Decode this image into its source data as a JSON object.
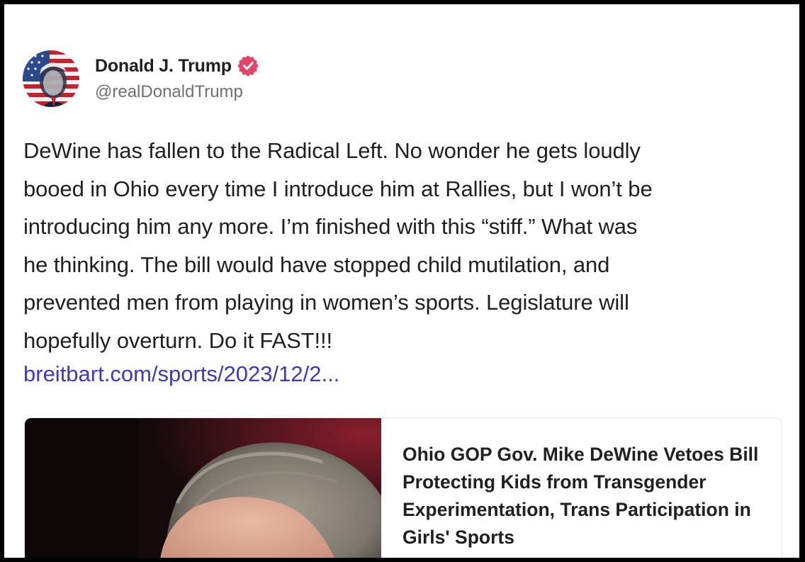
{
  "author": {
    "display_name": "Donald J. Trump",
    "handle": "@realDonaldTrump",
    "avatar_icon": "avatar-flag-portrait",
    "verified_icon": "verified-badge-icon"
  },
  "post": {
    "text": "DeWine has fallen to the Radical Left. No wonder he gets loudly booed in Ohio every time I introduce him at Rallies, but I won’t be introducing him any more. I’m finished with this “stiff.” What was he thinking. The bill would have stopped child mutilation, and prevented men from playing in women’s sports. Legislature will hopefully overturn. Do it FAST!!!",
    "lines": [
      "DeWine has fallen to the Radical Left. No wonder he gets loudly",
      "booed in Ohio every time I introduce him at Rallies, but I won’t be",
      "introducing him any more. I’m finished with this “stiff.” What was",
      "he thinking. The bill would have stopped child mutilation, and",
      "prevented men from playing in women’s sports. Legislature will",
      "hopefully overturn. Do it FAST!!!"
    ],
    "link_text": "breitbart.com/sports/2023/12/2..."
  },
  "link_card": {
    "title": "Ohio GOP Gov. Mike DeWine Vetoes Bill Protecting Kids from Transgender Experimentation, Trans Participation in Girls' Sports"
  },
  "colors": {
    "name": "#1f1f24",
    "handle": "#6f6f78",
    "text": "#202024",
    "link": "#3d3ab8",
    "verified_badge": "#e0476a",
    "frame_border": "#000000"
  }
}
